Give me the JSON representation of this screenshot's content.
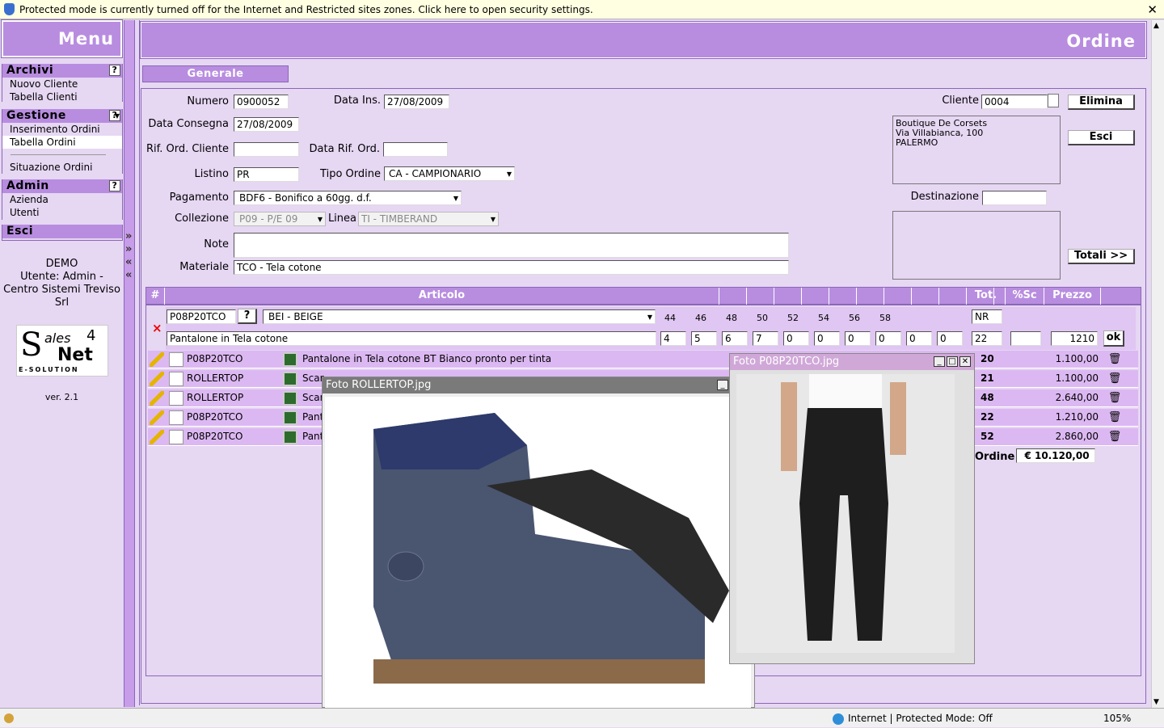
{
  "infobar": {
    "text": "Protected mode is currently turned off for the Internet and Restricted sites zones.  Click here to open security settings.",
    "close": "✕"
  },
  "menu": {
    "title": "Menu",
    "archivi": {
      "title": "Archivi",
      "help": "?",
      "items": [
        "Nuovo Cliente",
        "Tabella Clienti"
      ]
    },
    "gestione": {
      "title": "Gestione",
      "help": "?",
      "items": [
        "Inserimento Ordini",
        "Tabella Ordini",
        "Situazione Ordini"
      ]
    },
    "admin": {
      "title": "Admin",
      "help": "?",
      "items": [
        "Azienda",
        "Utenti"
      ]
    },
    "esci": "Esci",
    "user_line1": "DEMO",
    "user_line2": "Utente: Admin -",
    "user_line3": "Centro Sistemi Treviso",
    "user_line4": "Srl",
    "logo_text": "Sales 4 Net",
    "logo_sub": "E-SOLUTION",
    "version": "ver. 2.1"
  },
  "divider_arrows": [
    "»",
    "»",
    "«",
    "«"
  ],
  "page": {
    "title": "Ordine",
    "tab": "Generale"
  },
  "form": {
    "numero_label": "Numero",
    "numero": "0900052",
    "data_ins_label": "Data Ins.",
    "data_ins": "27/08/2009",
    "data_consegna_label": "Data Consegna",
    "data_consegna": "27/08/2009",
    "rif_ord_label": "Rif. Ord. Cliente",
    "rif_ord": "",
    "data_rif_label": "Data Rif. Ord.",
    "data_rif": "",
    "listino_label": "Listino",
    "listino": "PR",
    "tipo_ordine_label": "Tipo Ordine",
    "tipo_ordine": "CA - CAMPIONARIO",
    "pagamento_label": "Pagamento",
    "pagamento": "BDF6 - Bonifico a 60gg. d.f.",
    "collezione_label": "Collezione",
    "collezione": "P09 - P/E 09",
    "linea_label": "Linea",
    "linea": "TI - TIMBERAND",
    "note_label": "Note",
    "note": "",
    "materiale_label": "Materiale",
    "materiale": "TCO - Tela cotone",
    "cliente_label": "Cliente",
    "cliente": "0004",
    "cliente_addr1": "Boutique De Corsets",
    "cliente_addr2": "Via Villabianca, 100",
    "cliente_addr3": "PALERMO",
    "destinazione_label": "Destinazione",
    "destinazione": "",
    "elimina": "Elimina",
    "esci": "Esci",
    "totali": "Totali >>"
  },
  "grid": {
    "headers": {
      "hash": "#",
      "articolo": "Articolo",
      "tot": "Tot.",
      "sc": "%Sc",
      "prezzo": "Prezzo"
    },
    "sizes": [
      "44",
      "46",
      "48",
      "50",
      "52",
      "54",
      "56",
      "58"
    ],
    "entry": {
      "code": "P08P20TCO",
      "help": "?",
      "color": "BEI - BEIGE",
      "desc": "Pantalone in Tela cotone",
      "qty": [
        "4",
        "5",
        "6",
        "7",
        "0",
        "0",
        "0",
        "0",
        "0",
        "0"
      ],
      "um": "NR",
      "tot": "22",
      "sc": "",
      "price": "1210",
      "ok": "ok"
    },
    "rows": [
      {
        "code": "P08P20TCO",
        "desc": "Pantalone in Tela cotone BT Bianco pronto per tinta",
        "tot": "20",
        "prezzo": "1.100,00"
      },
      {
        "code": "ROLLERTOP",
        "desc": "Scar",
        "tot": "21",
        "prezzo": "1.100,00"
      },
      {
        "code": "ROLLERTOP",
        "desc": "Scar",
        "tot": "48",
        "prezzo": "2.640,00"
      },
      {
        "code": "P08P20TCO",
        "desc": "Pant",
        "tot": "22",
        "prezzo": "1.210,00"
      },
      {
        "code": "P08P20TCO",
        "desc": "Pant",
        "tot": "52",
        "prezzo": "2.860,00"
      }
    ],
    "total_label": "Ordine",
    "total": "€ 10.120,00"
  },
  "popup1": {
    "title": "Foto ROLLERTOP.jpg"
  },
  "popup2": {
    "title": "Foto P08P20TCO.jpg"
  },
  "statusbar": {
    "zone": "Internet | Protected Mode: Off",
    "zoom": "105%"
  }
}
